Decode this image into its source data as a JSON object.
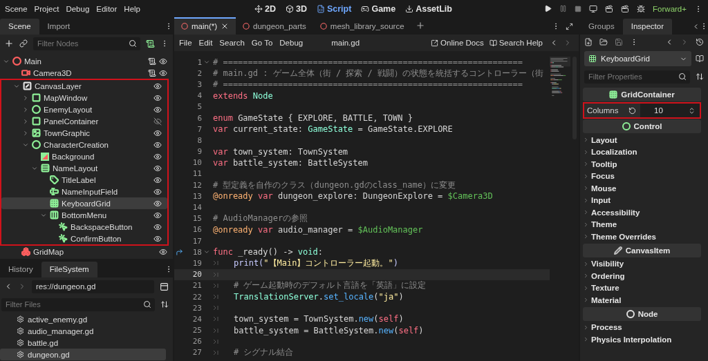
{
  "menu_bar": {
    "menus": [
      "Scene",
      "Project",
      "Debug",
      "Editor",
      "Help"
    ],
    "workspaces": [
      {
        "label": "2D",
        "selected": false
      },
      {
        "label": "3D",
        "selected": false
      },
      {
        "label": "Script",
        "selected": true
      },
      {
        "label": "Game",
        "selected": false
      },
      {
        "label": "AssetLib",
        "selected": false
      }
    ],
    "renderer": "Forward+"
  },
  "scene_dock": {
    "tabs": [
      {
        "label": "Scene",
        "selected": true
      },
      {
        "label": "Import",
        "selected": false
      }
    ],
    "filter": {
      "placeholder": "Filter Nodes"
    },
    "tree": [
      {
        "name": "Main",
        "kind": "node",
        "color": "#ff5f5f",
        "expanded": true,
        "script": true,
        "visible": true,
        "selected": false,
        "highlighted": false,
        "children": [
          {
            "name": "Camera3D",
            "kind": "camera",
            "color": "#ff5f5f",
            "script": true,
            "visible": true,
            "selected": false,
            "highlighted": false
          },
          {
            "name": "CanvasLayer",
            "kind": "canvas",
            "color": "#e0e0e0",
            "expanded": true,
            "script": false,
            "visible": true,
            "selected": false,
            "highlighted": true,
            "children": [
              {
                "name": "MapWindow",
                "kind": "panel",
                "color": "#8eef97",
                "expanded": false,
                "script": false,
                "visible": true,
                "selected": false,
                "highlighted": false
              },
              {
                "name": "EnemyLayout",
                "kind": "control",
                "color": "#8eef97",
                "expanded": false,
                "script": false,
                "visible": true,
                "selected": false,
                "highlighted": false
              },
              {
                "name": "PanelContainer",
                "kind": "panel",
                "color": "#8eef97",
                "expanded": false,
                "script": false,
                "visible": false,
                "selected": false,
                "highlighted": false
              },
              {
                "name": "TownGraphic",
                "kind": "texture",
                "color": "#8eef97",
                "expanded": false,
                "script": false,
                "visible": true,
                "selected": false,
                "highlighted": false
              },
              {
                "name": "CharacterCreation",
                "kind": "control",
                "color": "#8eef97",
                "expanded": true,
                "script": false,
                "visible": true,
                "selected": false,
                "highlighted": false,
                "children": [
                  {
                    "name": "Background",
                    "kind": "color_rect",
                    "color": "#8eef97",
                    "script": false,
                    "visible": true,
                    "selected": false,
                    "highlighted": false
                  },
                  {
                    "name": "NameLayout",
                    "kind": "vbox",
                    "color": "#8eef97",
                    "expanded": true,
                    "script": false,
                    "visible": true,
                    "selected": false,
                    "highlighted": false,
                    "children": [
                      {
                        "name": "TitleLabel",
                        "kind": "label",
                        "color": "#8eef97",
                        "script": false,
                        "visible": true,
                        "selected": false,
                        "highlighted": false
                      },
                      {
                        "name": "NameInputField",
                        "kind": "line_edit",
                        "color": "#8eef97",
                        "script": false,
                        "visible": true,
                        "selected": false,
                        "highlighted": false
                      },
                      {
                        "name": "KeyboardGrid",
                        "kind": "grid",
                        "color": "#8eef97",
                        "script": false,
                        "visible": true,
                        "selected": true,
                        "highlighted": false
                      },
                      {
                        "name": "BottomMenu",
                        "kind": "hbox",
                        "color": "#8eef97",
                        "expanded": true,
                        "script": false,
                        "visible": true,
                        "selected": false,
                        "highlighted": false,
                        "children": [
                          {
                            "name": "BackspaceButton",
                            "kind": "button",
                            "color": "#8eef97",
                            "script": false,
                            "visible": true,
                            "selected": false,
                            "highlighted": false
                          },
                          {
                            "name": "ConfirmButton",
                            "kind": "button",
                            "color": "#8eef97",
                            "script": false,
                            "visible": true,
                            "selected": false,
                            "highlighted": false
                          }
                        ]
                      }
                    ]
                  }
                ]
              }
            ]
          },
          {
            "name": "GridMap",
            "kind": "gridmap",
            "color": "#ff5f5f",
            "script": false,
            "visible": true,
            "selected": false,
            "highlighted": false
          }
        ]
      }
    ]
  },
  "filesystem_dock": {
    "tabs": [
      {
        "label": "History",
        "selected": false
      },
      {
        "label": "FileSystem",
        "selected": true
      }
    ],
    "path": "res://dungeon.gd",
    "filter": {
      "placeholder": "Filter Files"
    },
    "files": [
      {
        "name": "active_enemy.gd",
        "selected": false
      },
      {
        "name": "audio_manager.gd",
        "selected": false
      },
      {
        "name": "battle.gd",
        "selected": false
      },
      {
        "name": "dungeon.gd",
        "selected": true
      }
    ]
  },
  "script_editor": {
    "tabs": [
      {
        "label": "main(*)",
        "selected": true
      },
      {
        "label": "dungeon_parts",
        "selected": false
      },
      {
        "label": "mesh_library_source",
        "selected": false
      }
    ],
    "menus": [
      "File",
      "Edit",
      "Search",
      "Go To",
      "Debug"
    ],
    "file_title": "main.gd",
    "help_buttons": [
      "Online Docs",
      "Search Help"
    ],
    "lines": [
      {
        "number": "1",
        "fold": true,
        "current": false,
        "indent": false,
        "tokens": [
          {
            "kind": "comment",
            "text": "# ============================================================"
          }
        ]
      },
      {
        "number": "2",
        "fold": false,
        "current": false,
        "indent": false,
        "tokens": [
          {
            "kind": "comment",
            "text": "# main.gd : ゲーム全体（街 / 探索 / 戦闘）の状態を統括するコントローラー（街"
          }
        ]
      },
      {
        "number": "3",
        "fold": false,
        "current": false,
        "indent": false,
        "tokens": [
          {
            "kind": "comment",
            "text": "# ============================================================"
          }
        ]
      },
      {
        "number": "4",
        "fold": false,
        "current": false,
        "indent": false,
        "tokens": [
          {
            "kind": "keyword",
            "text": "extends"
          },
          {
            "kind": "type",
            "text": " Node"
          }
        ]
      },
      {
        "number": "5",
        "fold": false,
        "current": false,
        "indent": false
      },
      {
        "number": "6",
        "fold": false,
        "current": false,
        "indent": false,
        "tokens": [
          {
            "kind": "keyword",
            "text": "enum"
          },
          {
            "kind": "plain",
            "text": " GameState { EXPLORE, BATTLE, TOWN }"
          }
        ]
      },
      {
        "number": "7",
        "fold": false,
        "current": false,
        "indent": false,
        "tokens": [
          {
            "kind": "keyword",
            "text": "var"
          },
          {
            "kind": "plain",
            "text": " current_state: "
          },
          {
            "kind": "type",
            "text": "GameState"
          },
          {
            "kind": "plain",
            "text": " = GameState.EXPLORE"
          }
        ]
      },
      {
        "number": "8",
        "fold": false,
        "current": false,
        "indent": false
      },
      {
        "number": "9",
        "fold": false,
        "current": false,
        "indent": false,
        "tokens": [
          {
            "kind": "keyword",
            "text": "var"
          },
          {
            "kind": "plain",
            "text": " town_system: TownSystem"
          }
        ]
      },
      {
        "number": "10",
        "fold": false,
        "current": false,
        "indent": false,
        "tokens": [
          {
            "kind": "keyword",
            "text": "var"
          },
          {
            "kind": "plain",
            "text": " battle_system: BattleSystem"
          }
        ]
      },
      {
        "number": "11",
        "fold": false,
        "current": false,
        "indent": false
      },
      {
        "number": "12",
        "fold": false,
        "current": false,
        "indent": false,
        "tokens": [
          {
            "kind": "comment",
            "text": "# 型定義を自作のクラス（dungeon.gdのclass_name）に変更"
          }
        ]
      },
      {
        "number": "13",
        "fold": false,
        "current": false,
        "indent": false,
        "tokens": [
          {
            "kind": "annotation",
            "text": "@onready"
          },
          {
            "kind": "keyword",
            "text": " var"
          },
          {
            "kind": "plain",
            "text": " dungeon_explore: DungeonExplore = "
          },
          {
            "kind": "node_path",
            "text": "$Camera3D"
          }
        ]
      },
      {
        "number": "14",
        "fold": false,
        "current": false,
        "indent": false
      },
      {
        "number": "15",
        "fold": false,
        "current": false,
        "indent": false,
        "tokens": [
          {
            "kind": "comment",
            "text": "# AudioManagerの参照"
          }
        ]
      },
      {
        "number": "16",
        "fold": false,
        "current": false,
        "indent": false,
        "tokens": [
          {
            "kind": "annotation",
            "text": "@onready"
          },
          {
            "kind": "keyword",
            "text": " var"
          },
          {
            "kind": "plain",
            "text": " audio_manager = "
          },
          {
            "kind": "node_path",
            "text": "$AudioManager"
          }
        ]
      },
      {
        "number": "17",
        "fold": false,
        "current": false,
        "indent": false
      },
      {
        "number": "18",
        "fold": true,
        "current": false,
        "indent": false,
        "override": true,
        "tokens": [
          {
            "kind": "keyword",
            "text": "func"
          },
          {
            "kind": "plain",
            "text": " _ready() -> "
          },
          {
            "kind": "type",
            "text": "void"
          },
          {
            "kind": "plain",
            "text": ":"
          }
        ]
      },
      {
        "number": "19",
        "fold": false,
        "current": false,
        "indent": true,
        "tokens": [
          {
            "kind": "builtin",
            "text": "print("
          },
          {
            "kind": "string",
            "text": "\"【Main】コントローラー起動。\""
          },
          {
            "kind": "builtin",
            "text": ")"
          }
        ]
      },
      {
        "number": "20",
        "fold": false,
        "current": true,
        "indent": true
      },
      {
        "number": "21",
        "fold": false,
        "current": false,
        "indent": true,
        "tokens": [
          {
            "kind": "comment",
            "text": "# ゲーム起動時のデフォルト言語を「英語」に設定"
          }
        ]
      },
      {
        "number": "22",
        "fold": false,
        "current": false,
        "indent": true,
        "tokens": [
          {
            "kind": "type",
            "text": "TranslationServer"
          },
          {
            "kind": "plain",
            "text": "."
          },
          {
            "kind": "method",
            "text": "set_locale"
          },
          {
            "kind": "plain",
            "text": "("
          },
          {
            "kind": "string",
            "text": "\"ja\""
          },
          {
            "kind": "plain",
            "text": ")"
          }
        ]
      },
      {
        "number": "23",
        "fold": false,
        "current": false,
        "indent": true
      },
      {
        "number": "24",
        "fold": false,
        "current": false,
        "indent": true,
        "tokens": [
          {
            "kind": "plain",
            "text": "town_system = TownSystem."
          },
          {
            "kind": "method",
            "text": "new"
          },
          {
            "kind": "plain",
            "text": "("
          },
          {
            "kind": "self",
            "text": "self"
          },
          {
            "kind": "plain",
            "text": ")"
          }
        ]
      },
      {
        "number": "25",
        "fold": false,
        "current": false,
        "indent": true,
        "tokens": [
          {
            "kind": "plain",
            "text": "battle_system = BattleSystem."
          },
          {
            "kind": "method",
            "text": "new"
          },
          {
            "kind": "plain",
            "text": "("
          },
          {
            "kind": "self",
            "text": "self"
          },
          {
            "kind": "plain",
            "text": ")"
          }
        ]
      },
      {
        "number": "26",
        "fold": false,
        "current": false,
        "indent": true
      },
      {
        "number": "27",
        "fold": false,
        "current": false,
        "indent": true,
        "tokens": [
          {
            "kind": "comment",
            "text": "# シグナル結合"
          }
        ]
      }
    ]
  },
  "inspector": {
    "tabs": [
      {
        "label": "Groups",
        "selected": false
      },
      {
        "label": "Inspector",
        "selected": true
      }
    ],
    "node": "KeyboardGrid",
    "filter": {
      "placeholder": "Filter Properties"
    },
    "sections": [
      {
        "kind": "header",
        "title": "GridContainer",
        "color": "#8eef97"
      },
      {
        "kind": "property",
        "label": "Columns",
        "value": "10",
        "highlighted": true
      },
      {
        "kind": "header",
        "title": "Control",
        "color": "#8eef97"
      },
      {
        "kind": "group",
        "label": "Layout"
      },
      {
        "kind": "group",
        "label": "Localization"
      },
      {
        "kind": "group",
        "label": "Tooltip"
      },
      {
        "kind": "group",
        "label": "Focus"
      },
      {
        "kind": "group",
        "label": "Mouse"
      },
      {
        "kind": "group",
        "label": "Input"
      },
      {
        "kind": "group",
        "label": "Accessibility"
      },
      {
        "kind": "group",
        "label": "Theme"
      },
      {
        "kind": "group",
        "label": "Theme Overrides"
      },
      {
        "kind": "header",
        "title": "CanvasItem",
        "color": "#bdbdbd"
      },
      {
        "kind": "group",
        "label": "Visibility"
      },
      {
        "kind": "group",
        "label": "Ordering"
      },
      {
        "kind": "group",
        "label": "Texture"
      },
      {
        "kind": "group",
        "label": "Material"
      },
      {
        "kind": "header",
        "title": "Node",
        "color": "#e0e0e0"
      },
      {
        "kind": "group",
        "label": "Process"
      },
      {
        "kind": "group",
        "label": "Physics Interpolation"
      }
    ]
  }
}
